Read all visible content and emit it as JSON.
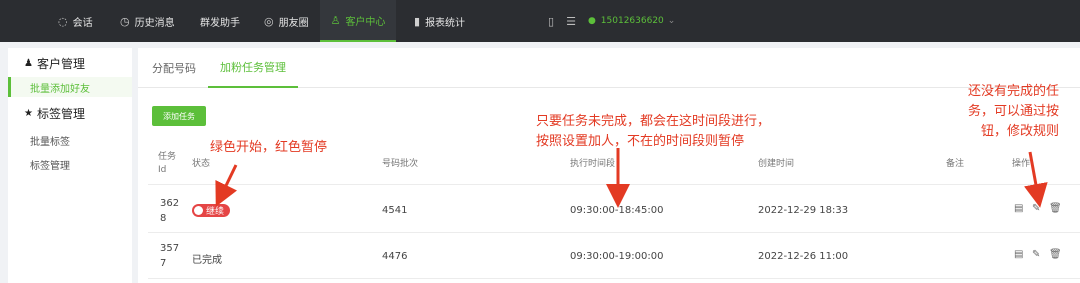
{
  "topnav": {
    "items": [
      {
        "label": "会话",
        "icon": "chat-icon"
      },
      {
        "label": "历史消息",
        "icon": "clock-icon"
      },
      {
        "label": "群发助手",
        "icon": ""
      },
      {
        "label": "朋友圈",
        "icon": "moments-icon"
      },
      {
        "label": "客户中心",
        "icon": "user-icon"
      },
      {
        "label": "报表统计",
        "icon": "bar-chart-icon"
      }
    ],
    "active_index": 4,
    "phone": "15012636620"
  },
  "sidebar": {
    "group1": "客户管理",
    "group1_items": [
      "批量添加好友"
    ],
    "group2": "标签管理",
    "group2_items": [
      "批量标签",
      "标签管理"
    ]
  },
  "tabs": [
    "分配号码",
    "加粉任务管理"
  ],
  "toolbar": {
    "add_label": "添加任务"
  },
  "table": {
    "headers": {
      "id_line1": "任务",
      "id_line2": "Id",
      "status": "状态",
      "batch": "号码批次",
      "time": "执行时间段",
      "created": "创建时间",
      "note": "备注",
      "ops": "操作"
    },
    "rows": [
      {
        "id_line1": "362",
        "id_line2": "8",
        "status": "继续",
        "batch": "4541",
        "time": "09:30:00-18:45:00",
        "created": "2022-12-29 18:33"
      },
      {
        "id_line1": "357",
        "id_line2": "7",
        "status": "已完成",
        "batch": "4476",
        "time": "09:30:00-19:00:00",
        "created": "2022-12-26 11:00"
      }
    ]
  },
  "annotations": {
    "status_note": "绿色开始，红色暂停",
    "time_note_line1": "只要任务未完成，都会在这时间段进行，",
    "time_note_line2": "按照设置加人，不在的时间段则暂停",
    "ops_note_line1": "还没有完成的任",
    "ops_note_line2": "务，可以通过按",
    "ops_note_line3": "钮，修改规则"
  },
  "colors": {
    "accent": "#5cbf3a",
    "danger": "#e54545",
    "annotation": "#e33a23",
    "nav_bg": "#2b2d31"
  }
}
